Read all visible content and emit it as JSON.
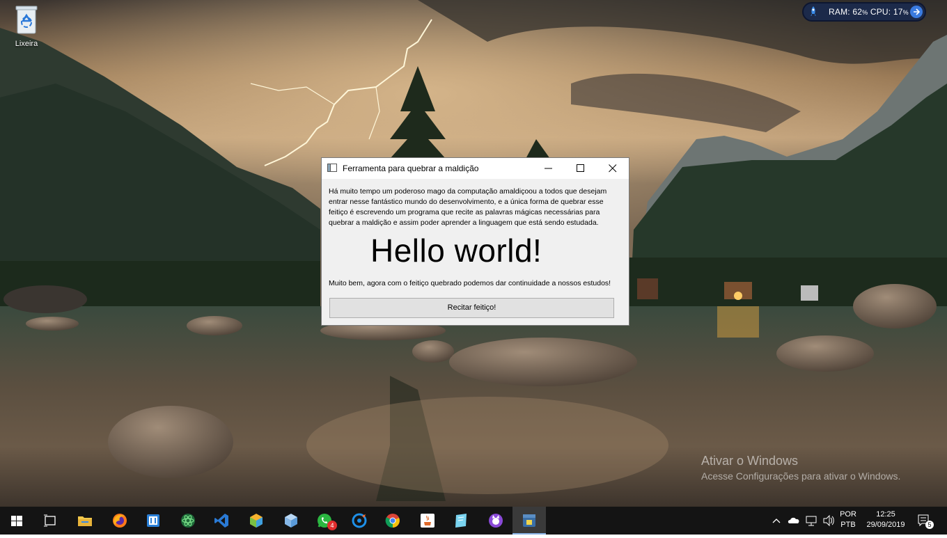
{
  "desktop": {
    "recycle_bin_label": "Lixeira",
    "watermark": {
      "title": "Ativar o Windows",
      "subtitle": "Acesse Configurações para ativar o Windows."
    }
  },
  "system_monitor": {
    "ram_label": "RAM:",
    "ram_value": "62",
    "cpu_label": "CPU:",
    "cpu_value": "17",
    "unit": "%"
  },
  "window": {
    "title": "Ferramenta para quebrar a maldição",
    "intro_text": "Há muito tempo um poderoso mago da computação amaldiçoou a todos que desejam entrar nesse fantástico mundo do desenvolvimento, e a única forma de quebrar esse feitiço é escrevendo um programa que recite as palavras mágicas necessárias para quebrar a maldição e assim poder aprender a linguagem que está sendo estudada.",
    "hello_text": "Hello world!",
    "success_text": "Muito bem, agora com o feitiço quebrado podemos dar continuidade a nossos estudos!",
    "button_label": "Recitar feitiço!"
  },
  "taskbar": {
    "icons": [
      "windows-start-icon",
      "task-view-icon",
      "file-explorer-icon",
      "firefox-icon",
      "app-icon",
      "atom-icon",
      "vscode-icon",
      "box-app-icon",
      "cube-app-icon",
      "whatsapp-icon",
      "browser-app-icon",
      "chrome-icon",
      "java-icon",
      "notes-app-icon",
      "github-desktop-icon",
      "python-app-icon"
    ],
    "whatsapp_badge": "4",
    "language_top": "POR",
    "language_bottom": "PTB",
    "time": "12:25",
    "date": "29/09/2019",
    "notification_count": "5"
  },
  "colors": {
    "taskbar": "#141414",
    "vscode": "#2a7ad5",
    "chrome_red": "#db4437",
    "meter_bg": "#1c2a4a"
  }
}
